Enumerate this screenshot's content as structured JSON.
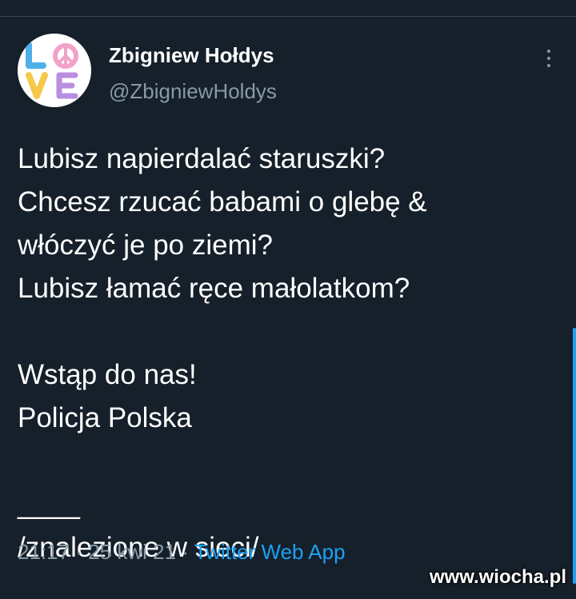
{
  "tweet": {
    "author": {
      "display_name": "Zbigniew Hołdys",
      "handle": "@ZbigniewHoldys",
      "avatar_icon": "love-logo-icon"
    },
    "text_lines": [
      "Lubisz napierdalać staruszki?",
      "Chcesz rzucać babami o glebę &",
      "włóczyć je po ziemi?",
      "Lubisz łamać ręce małolatkom?",
      "",
      "Wstąp do nas!",
      "Policja Polska",
      "",
      "____",
      "/znalezione w sieci/"
    ],
    "time": "21:17",
    "separator": "·",
    "date": "25 kwi 21",
    "source": "Twitter Web App"
  },
  "watermark": "www.wiocha.pl",
  "colors": {
    "background": "#15202b",
    "secondary_text": "#8899a6",
    "accent": "#1da1f2",
    "divider": "#38444d"
  }
}
